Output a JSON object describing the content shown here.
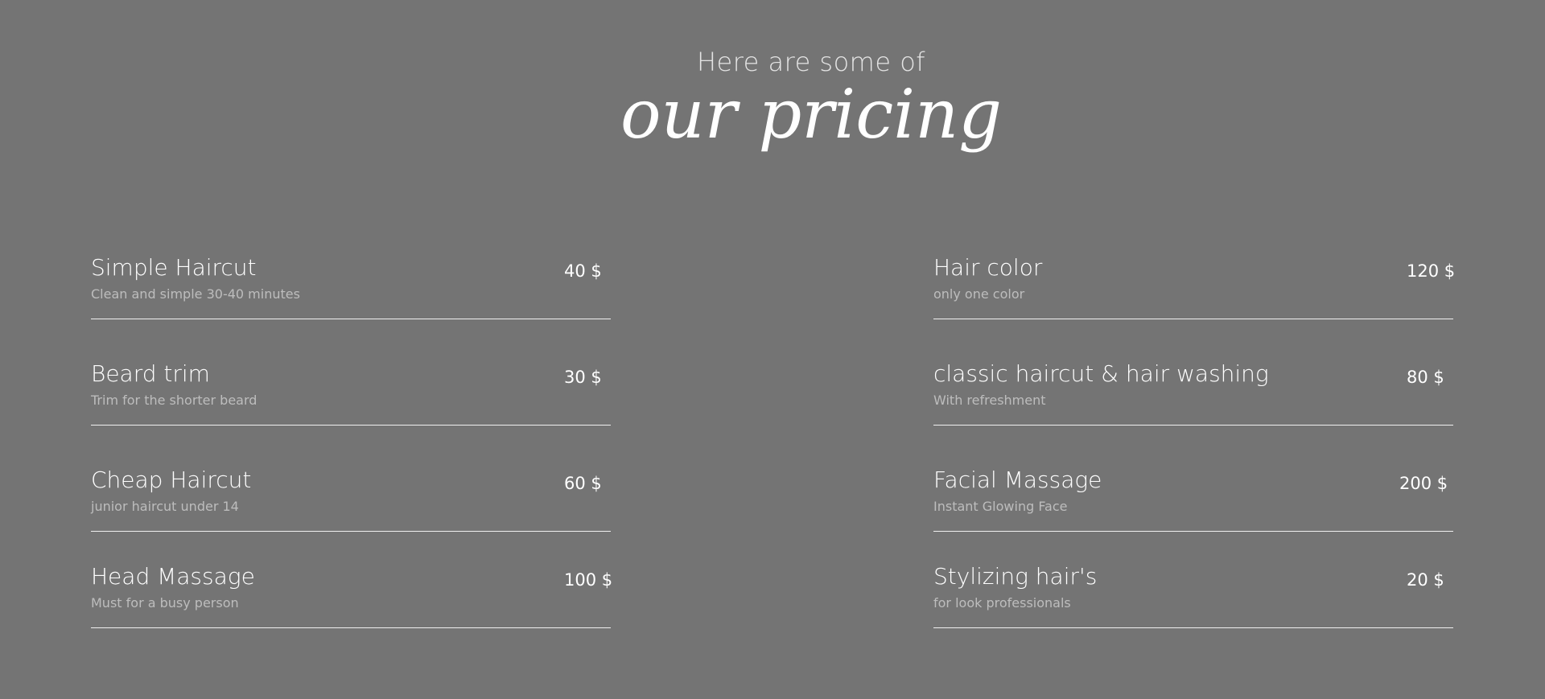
{
  "header": {
    "pretitle": "Here are some of",
    "title": "our pricing"
  },
  "left_items": [
    {
      "name": "Simple Haircut",
      "desc": "Clean and simple 30-40 minutes",
      "price": "40 $"
    },
    {
      "name": "Beard trim",
      "desc": "Trim for the shorter beard",
      "price": "30 $"
    },
    {
      "name": "Cheap Haircut",
      "desc": "junior haircut under 14",
      "price": "60 $"
    },
    {
      "name": "Head Massage",
      "desc": "Must for a busy person",
      "price": "100 $"
    }
  ],
  "right_items": [
    {
      "name": "Hair color",
      "desc": "only one color",
      "price": "120 $"
    },
    {
      "name": "classic haircut & hair washing",
      "desc": "With refreshment",
      "price": "80 $"
    },
    {
      "name": "Facial Massage",
      "desc": "Instant Glowing Face",
      "price": "200 $"
    },
    {
      "name": "Stylizing hair's",
      "desc": "for look professionals",
      "price": "20 $"
    }
  ],
  "colors": {
    "background": "#747474",
    "text": "#ffffff",
    "muted": "#bdbdbd"
  }
}
